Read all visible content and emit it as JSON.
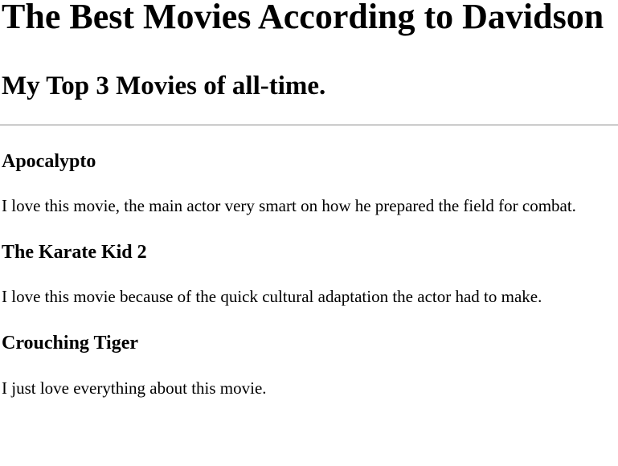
{
  "page_title": "The Best Movies According to Davidson",
  "subtitle": "My Top 3 Movies of all-time.",
  "movies": [
    {
      "title": "Apocalypto",
      "description": "I love this movie, the main actor very smart on how he prepared the field for combat."
    },
    {
      "title": "The Karate Kid 2",
      "description": "I love this movie because of the quick cultural adaptation the actor had to make."
    },
    {
      "title": "Crouching Tiger",
      "description": "I just love everything about this movie."
    }
  ]
}
